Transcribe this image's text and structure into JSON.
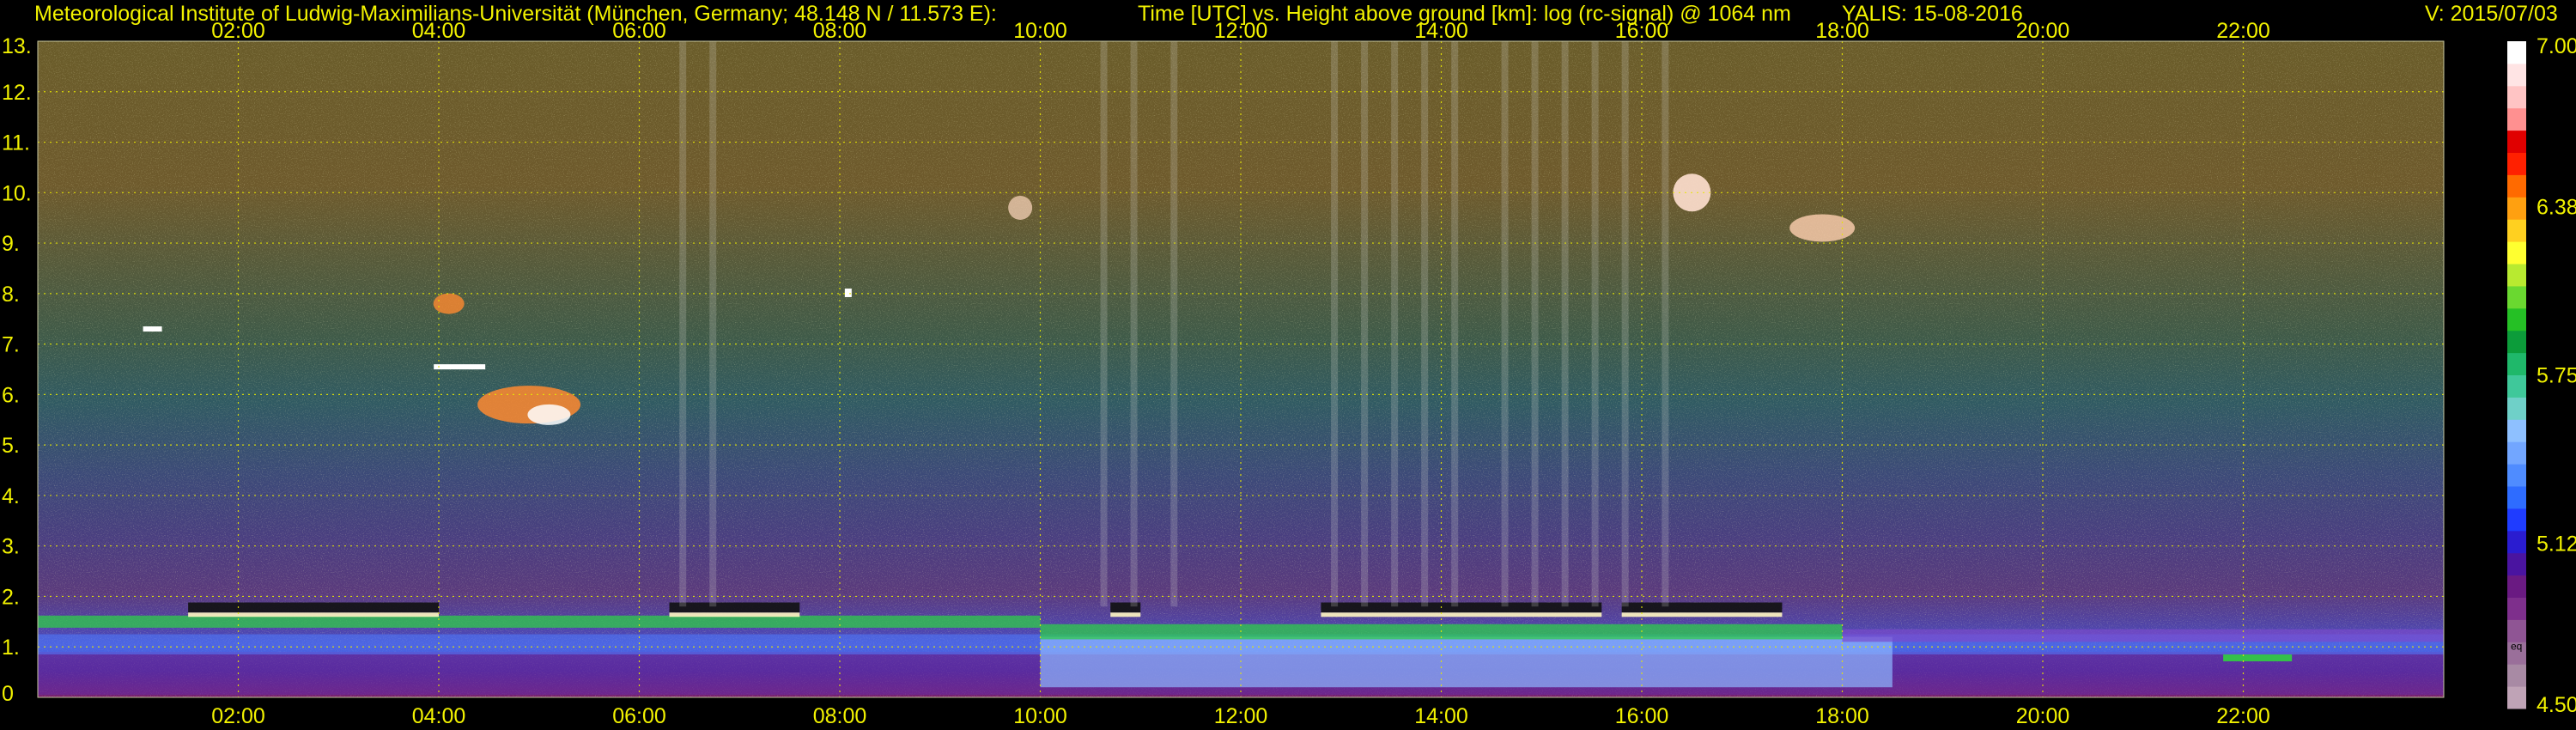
{
  "header": {
    "institute": "Meteorological Institute of Ludwig-Maximilians-Universität (München, Germany; 48.148 N / 11.573 E):",
    "axes_desc": "Time [UTC] vs. Height above ground [km]: log (rc-signal) @ 1064 nm",
    "instrument": "YALIS: 15-08-2016",
    "version": "V: 2015/07/03"
  },
  "chart_data": {
    "type": "heatmap",
    "title": "Time [UTC] vs. Height above ground [km]: log (rc-signal) @ 1064 nm",
    "xlabel": "Time [UTC]",
    "ylabel": "Height above ground [km]",
    "x_range_hours": [
      0,
      24
    ],
    "x_ticks": [
      "02:00",
      "04:00",
      "06:00",
      "08:00",
      "10:00",
      "12:00",
      "14:00",
      "16:00",
      "18:00",
      "20:00",
      "22:00"
    ],
    "y_range_km": [
      0,
      13
    ],
    "y_ticks": [
      "0",
      "1.",
      "2.",
      "3.",
      "4.",
      "5.",
      "6.",
      "7.",
      "8.",
      "9.",
      "10.",
      "11.",
      "12.",
      "13."
    ],
    "grid": true,
    "colorbar": {
      "range": [
        4.5,
        7.0
      ],
      "ticks": [
        "7.00",
        "6.38",
        "5.75",
        "5.12",
        "4.50"
      ],
      "tick_values": [
        7.0,
        6.38,
        5.75,
        5.12,
        4.5
      ],
      "note": "eq",
      "colors": [
        "#bfa3b6",
        "#a88aa4",
        "#9a6f9a",
        "#8f5594",
        "#7e2f8c",
        "#6a1a82",
        "#4a14a0",
        "#2a1cd0",
        "#1f3cff",
        "#2e6cff",
        "#4f8cff",
        "#72a6ff",
        "#8ec0ff",
        "#6fd0c8",
        "#3fc89a",
        "#1fb86a",
        "#0c9c3a",
        "#25c025",
        "#6ad830",
        "#b8ea30",
        "#ffff30",
        "#ffd020",
        "#ffa010",
        "#ff6a00",
        "#ff2000",
        "#e00000",
        "#ff9090",
        "#ffc4c4",
        "#ffe4e4",
        "#ffffff"
      ]
    },
    "features": {
      "boundary_layer_top_km": 1.5,
      "low_clouds_km": 1.8,
      "mid_cloud_km": 5.8,
      "cirrus_km": 9.5
    }
  }
}
